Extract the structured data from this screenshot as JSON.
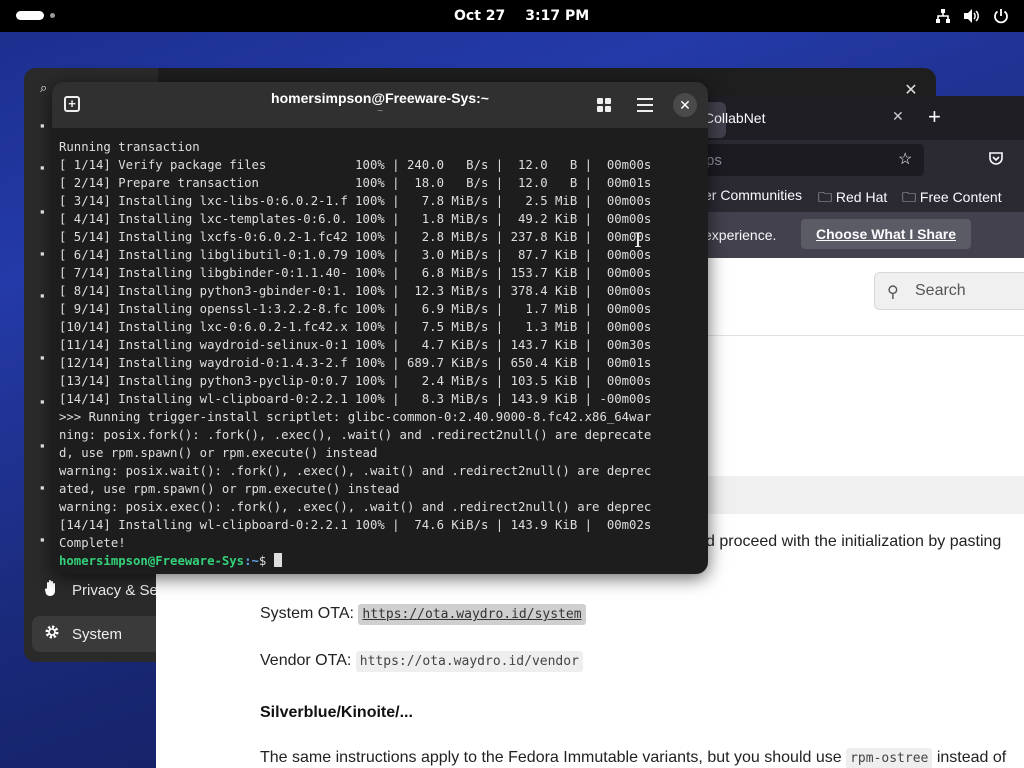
{
  "topbar": {
    "date": "Oct 27",
    "time": "3:17 PM"
  },
  "settings": {
    "side_items": [
      {
        "label": "Privacy & Sec",
        "icon": "hand-icon"
      },
      {
        "label": "System",
        "icon": "gear-icon"
      }
    ]
  },
  "browser": {
    "tab_label": "CollabNet",
    "url_text": "ps",
    "bookmarks": [
      "er Communities",
      "Red Hat",
      "Free Content"
    ],
    "notice_text": "experience.",
    "notice_button": "Choose What I Share",
    "search_placeholder": "Search",
    "content": {
      "para1": "d proceed with the initialization by pasting",
      "system_ota_label": "System OTA:",
      "system_ota_url": "https://ota.waydro.id/system",
      "vendor_ota_label": "Vendor OTA:",
      "vendor_ota_url": "https://ota.waydro.id/vendor",
      "heading": "Silverblue/Kinoite/...",
      "para2_start": "The same instructions apply to the Fedora Immutable variants, but you should use",
      "para2_code": "rpm-ostree",
      "para2_end": "instead of"
    }
  },
  "terminal": {
    "title": "homersimpson@Freeware-Sys:~",
    "subtitle": "~",
    "lines": [
      "Running transaction",
      "[ 1/14] Verify package files            100% | 240.0   B/s |  12.0   B |  00m00s",
      "[ 2/14] Prepare transaction             100% |  18.0   B/s |  12.0   B |  00m01s",
      "[ 3/14] Installing lxc-libs-0:6.0.2-1.f 100% |   7.8 MiB/s |   2.5 MiB |  00m00s",
      "[ 4/14] Installing lxc-templates-0:6.0. 100% |   1.8 MiB/s |  49.2 KiB |  00m00s",
      "[ 5/14] Installing lxcfs-0:6.0.2-1.fc42 100% |   2.8 MiB/s | 237.8 KiB |  00m00s",
      "[ 6/14] Installing libglibutil-0:1.0.79 100% |   3.0 MiB/s |  87.7 KiB |  00m00s",
      "[ 7/14] Installing libgbinder-0:1.1.40- 100% |   6.8 MiB/s | 153.7 KiB |  00m00s",
      "[ 8/14] Installing python3-gbinder-0:1. 100% |  12.3 MiB/s | 378.4 KiB |  00m00s",
      "[ 9/14] Installing openssl-1:3.2.2-8.fc 100% |   6.9 MiB/s |   1.7 MiB |  00m00s",
      "[10/14] Installing lxc-0:6.0.2-1.fc42.x 100% |   7.5 MiB/s |   1.3 MiB |  00m00s",
      "[11/14] Installing waydroid-selinux-0:1 100% |   4.7 KiB/s | 143.7 KiB |  00m30s",
      "[12/14] Installing waydroid-0:1.4.3-2.f 100% | 689.7 KiB/s | 650.4 KiB |  00m01s",
      "[13/14] Installing python3-pyclip-0:0.7 100% |   2.4 MiB/s | 103.5 KiB |  00m00s",
      "[14/14] Installing wl-clipboard-0:2.2.1 100% |   8.3 MiB/s | 143.9 KiB | -00m00s",
      ">>> Running trigger-install scriptlet: glibc-common-0:2.40.9000-8.fc42.x86_64war",
      "ning: posix.fork(): .fork(), .exec(), .wait() and .redirect2null() are deprecate",
      "d, use rpm.spawn() or rpm.execute() instead",
      "warning: posix.wait(): .fork(), .exec(), .wait() and .redirect2null() are deprec",
      "ated, use rpm.spawn() or rpm.execute() instead",
      "warning: posix.exec(): .fork(), .exec(), .wait() and .redirect2null() are deprec",
      "[14/14] Installing wl-clipboard-0:2.2.1 100% |  74.6 KiB/s | 143.9 KiB |  00m02s",
      "Complete!"
    ],
    "prompt_user": "homersimpson@Freeware-Sys",
    "prompt_path": ":~",
    "prompt_symbol": "$ "
  }
}
